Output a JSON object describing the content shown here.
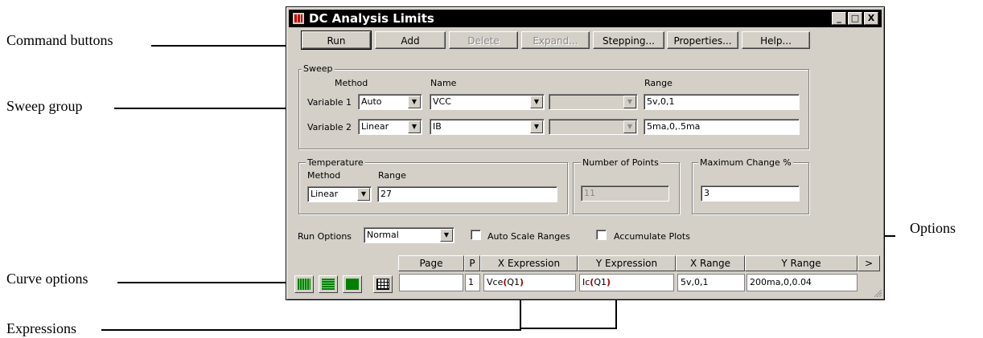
{
  "callouts": {
    "command_buttons": "Command buttons",
    "sweep_group": "Sweep group",
    "curve_options": "Curve options",
    "expressions": "Expressions",
    "options": "Options"
  },
  "window": {
    "title": "DC Analysis Limits",
    "controls": [
      "_",
      "□",
      "X"
    ]
  },
  "buttons": {
    "run": "Run",
    "add": "Add",
    "delete": "Delete",
    "expand": "Expand...",
    "stepping": "Stepping...",
    "properties": "Properties...",
    "help": "Help..."
  },
  "sweep": {
    "group_label": "Sweep",
    "method_header": "Method",
    "name_header": "Name",
    "range_header": "Range",
    "variables": [
      {
        "label": "Variable 1",
        "method": "Auto",
        "name": "VCC",
        "range": "5v,0,1"
      },
      {
        "label": "Variable 2",
        "method": "Linear",
        "name": "IB",
        "range": "5ma,0,.5ma"
      }
    ]
  },
  "temperature": {
    "group_label": "Temperature",
    "method_label": "Method",
    "range_label": "Range",
    "method": "Linear",
    "range": "27"
  },
  "points": {
    "group_label": "Number of Points",
    "value": "11"
  },
  "max_change": {
    "group_label": "Maximum Change %",
    "value": "3"
  },
  "run_options": {
    "label": "Run Options",
    "value": "Normal",
    "auto_scale": "Auto Scale Ranges",
    "accumulate": "Accumulate Plots"
  },
  "table": {
    "headers": [
      "Page",
      "P",
      "X Expression",
      "Y Expression",
      "X Range",
      "Y Range",
      ">"
    ],
    "row": {
      "page": "",
      "p": "1",
      "x_expr_prefix": "Vce",
      "x_expr_arg": "Q1",
      "y_expr_prefix": "Ic",
      "y_expr_arg": "Q1",
      "x_range": "5v,0,1",
      "y_range": "200ma,0,0.04"
    }
  },
  "colors": {
    "accent_green": "#008000",
    "title_bar": "#000000",
    "paren_red": "#b00000"
  }
}
